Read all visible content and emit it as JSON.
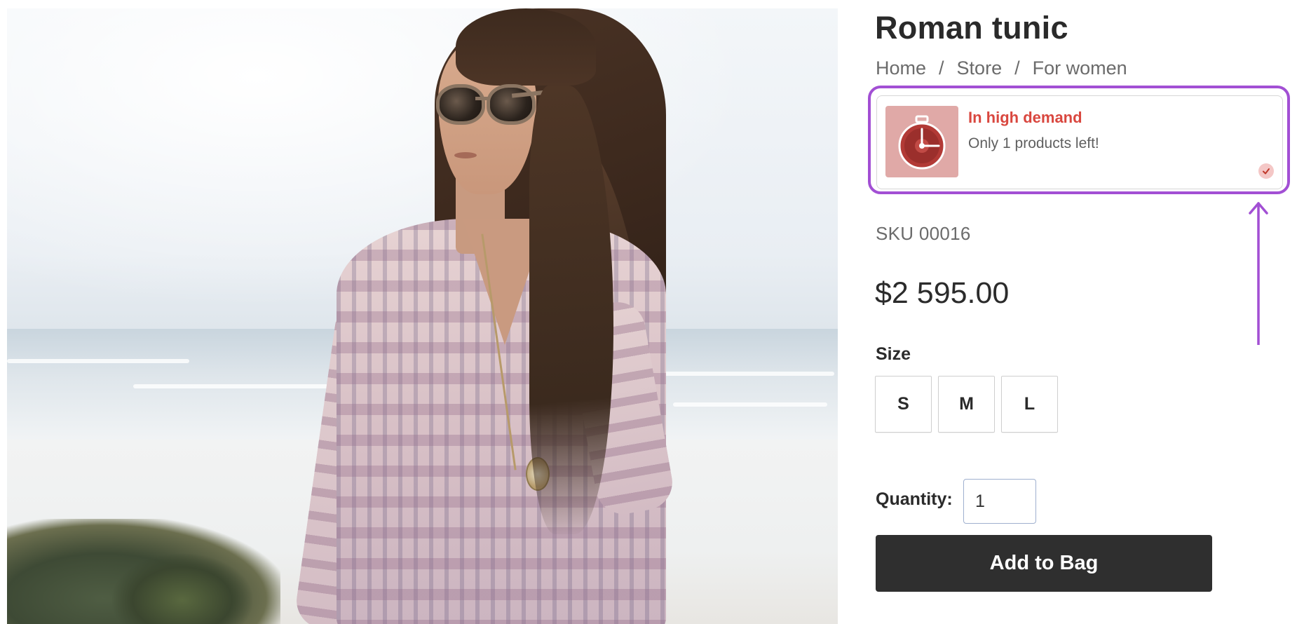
{
  "product": {
    "title": "Roman tunic",
    "sku": "SKU 00016",
    "price": "$2 595.00"
  },
  "breadcrumb": {
    "items": [
      "Home",
      "Store",
      "For women"
    ],
    "separator": "/"
  },
  "demand_widget": {
    "title": "In high demand",
    "message": "Only 1 products left!",
    "title_color": "#d9473f",
    "thumb_color": "#e0a9a7",
    "highlight_color": "#a24fd4",
    "icon": "stopwatch-icon",
    "status_icon": "check-icon"
  },
  "size": {
    "label": "Size",
    "options": [
      "S",
      "M",
      "L"
    ]
  },
  "quantity": {
    "label": "Quantity:",
    "value": "1"
  },
  "actions": {
    "add_to_bag": "Add to Bag",
    "button_color": "#2f2f2f"
  }
}
